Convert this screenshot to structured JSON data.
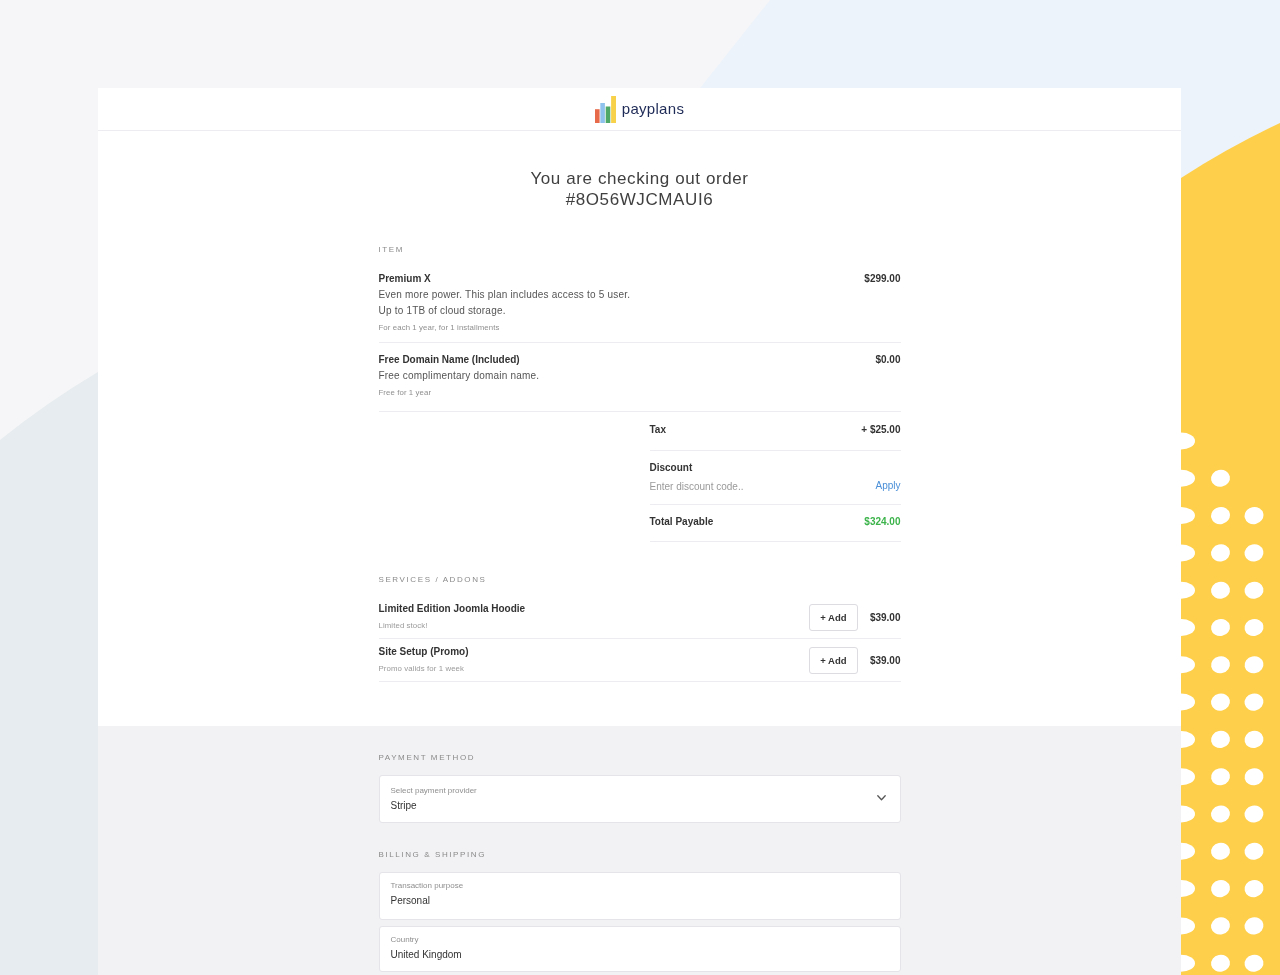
{
  "header": {
    "brand": "payplans"
  },
  "heading": "You are checking out order #8O56WJCMAUI6",
  "items_section": {
    "label": "ITEM",
    "items": [
      {
        "name": "Premium X",
        "price": "$299.00",
        "details": [
          "Even more power. This plan includes access to 5 user.",
          "Up to 1TB of cloud storage."
        ],
        "term": "For each 1 year, for 1 installments"
      },
      {
        "name": "Free Domain Name (Included)",
        "price": "$0.00",
        "details": [
          "Free complimentary domain name."
        ],
        "term": "Free for 1 year"
      }
    ]
  },
  "summary": [
    {
      "kind": "amount",
      "label": "Tax",
      "value": "+ $25.00"
    },
    {
      "kind": "discount",
      "label": "Discount",
      "placeholder": "Enter discount code..",
      "action": "Apply"
    },
    {
      "kind": "total",
      "label": "Total Payable",
      "value": "$324.00"
    }
  ],
  "addons_section": {
    "label": "SERVICES / ADDONS",
    "addons": [
      {
        "name": "Limited Edition Joomla Hoodie",
        "note": "Limited stock!",
        "button": "+ Add",
        "price": "$39.00"
      },
      {
        "name": "Site Setup (Promo)",
        "note": "Promo valids for 1 week",
        "button": "+ Add",
        "price": "$39.00"
      }
    ]
  },
  "payment_section": {
    "label": "PAYMENT METHOD",
    "select": {
      "label": "Select payment provider",
      "value": "Stripe"
    }
  },
  "billing_section": {
    "label": "BILLING & SHIPPING",
    "fields": [
      {
        "label": "Transaction purpose",
        "value": "Personal"
      },
      {
        "label": "Country",
        "value": "United Kingdom"
      }
    ]
  }
}
